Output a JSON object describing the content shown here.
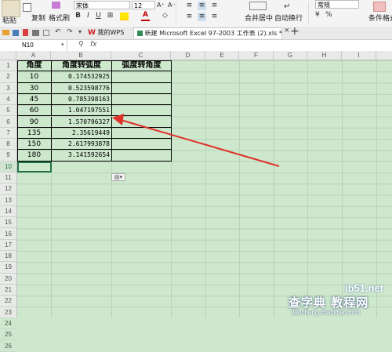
{
  "ribbon": {
    "paste": "粘贴",
    "copy": "复制",
    "format_painter": "格式刷",
    "font_name": "宋体",
    "font_size": "12",
    "merge_center": "合并居中",
    "wrap_text": "自动换行",
    "number_format": "常规",
    "conditional_format": "条件格式"
  },
  "tabs": {
    "wps": "我的WPS",
    "doc": "新建 Microsoft Excel 97-2003 工作表 (2).xls *"
  },
  "formula_bar": {
    "cell_ref": "N10",
    "fx": "fx"
  },
  "columns": [
    "A",
    "B",
    "C",
    "D",
    "E",
    "F",
    "G",
    "H",
    "I"
  ],
  "rows": [
    "1",
    "2",
    "3",
    "4",
    "5",
    "6",
    "7",
    "8",
    "9",
    "10",
    "11",
    "12",
    "13",
    "14",
    "15",
    "16",
    "17",
    "18",
    "19",
    "20",
    "21",
    "22",
    "23",
    "24",
    "25",
    "26"
  ],
  "table": {
    "headers": [
      "角度",
      "角度转弧度",
      "弧度转角度"
    ],
    "rows": [
      {
        "a": "10",
        "b": "0.174532925"
      },
      {
        "a": "30",
        "b": "0.523598776"
      },
      {
        "a": "45",
        "b": "0.785398163"
      },
      {
        "a": "60",
        "b": "1.047197551"
      },
      {
        "a": "90",
        "b": "1.570796327"
      },
      {
        "a": "135",
        "b": "2.35619449"
      },
      {
        "a": "150",
        "b": "2.617993878"
      },
      {
        "a": "180",
        "b": "3.141592654"
      }
    ]
  },
  "watermark": {
    "site": "ib51.net",
    "brand": "查字典 教程网",
    "url": "jiaocheng.chazidian.com"
  }
}
